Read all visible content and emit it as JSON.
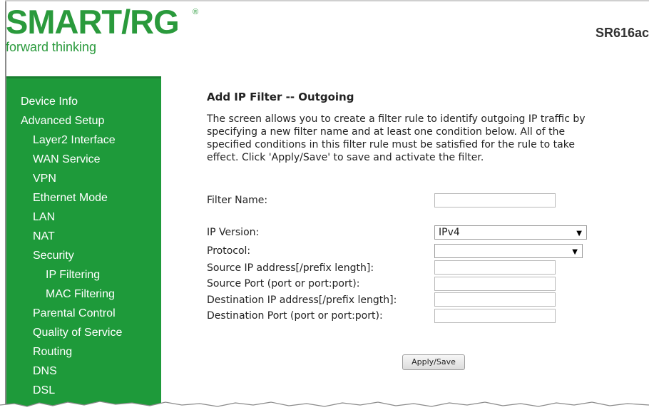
{
  "brand": {
    "logo_text": "SMART/RG",
    "registered": "®",
    "tagline": "forward thinking",
    "model": "SR616ac"
  },
  "sidebar": {
    "items": [
      {
        "label": "Device Info"
      },
      {
        "label": "Advanced Setup"
      },
      {
        "label": "Layer2 Interface"
      },
      {
        "label": "WAN Service"
      },
      {
        "label": "VPN"
      },
      {
        "label": "Ethernet Mode"
      },
      {
        "label": "LAN"
      },
      {
        "label": "NAT"
      },
      {
        "label": "Security"
      },
      {
        "label": "IP Filtering"
      },
      {
        "label": "MAC Filtering"
      },
      {
        "label": "Parental Control"
      },
      {
        "label": "Quality of Service"
      },
      {
        "label": "Routing"
      },
      {
        "label": "DNS"
      },
      {
        "label": "DSL"
      }
    ]
  },
  "main": {
    "title": "Add IP Filter -- Outgoing",
    "description_lines": [
      "The screen allows you to create a filter rule to identify outgoing IP traffic by",
      "specifying a new filter name and at least one condition below. All of the",
      "specified conditions in this filter rule must be satisfied for the rule to take",
      "effect. Click 'Apply/Save' to save and activate the filter."
    ]
  },
  "form": {
    "filter_name": {
      "label": "Filter Name:",
      "value": ""
    },
    "ip_version": {
      "label": "IP Version:",
      "value": "IPv4"
    },
    "protocol": {
      "label": "Protocol:",
      "value": ""
    },
    "source_ip": {
      "label": "Source IP address[/prefix length]:",
      "value": ""
    },
    "source_port": {
      "label": "Source Port (port or port:port):",
      "value": ""
    },
    "dest_ip": {
      "label": "Destination IP address[/prefix length]:",
      "value": ""
    },
    "dest_port": {
      "label": "Destination Port (port or port:port):",
      "value": ""
    }
  },
  "actions": {
    "apply_save_label": "Apply/Save"
  },
  "icons": {
    "dropdown": "chevron-down-icon"
  },
  "colors": {
    "brand_green": "#2a9a3c",
    "sidebar_green": "#1e9a3a"
  }
}
